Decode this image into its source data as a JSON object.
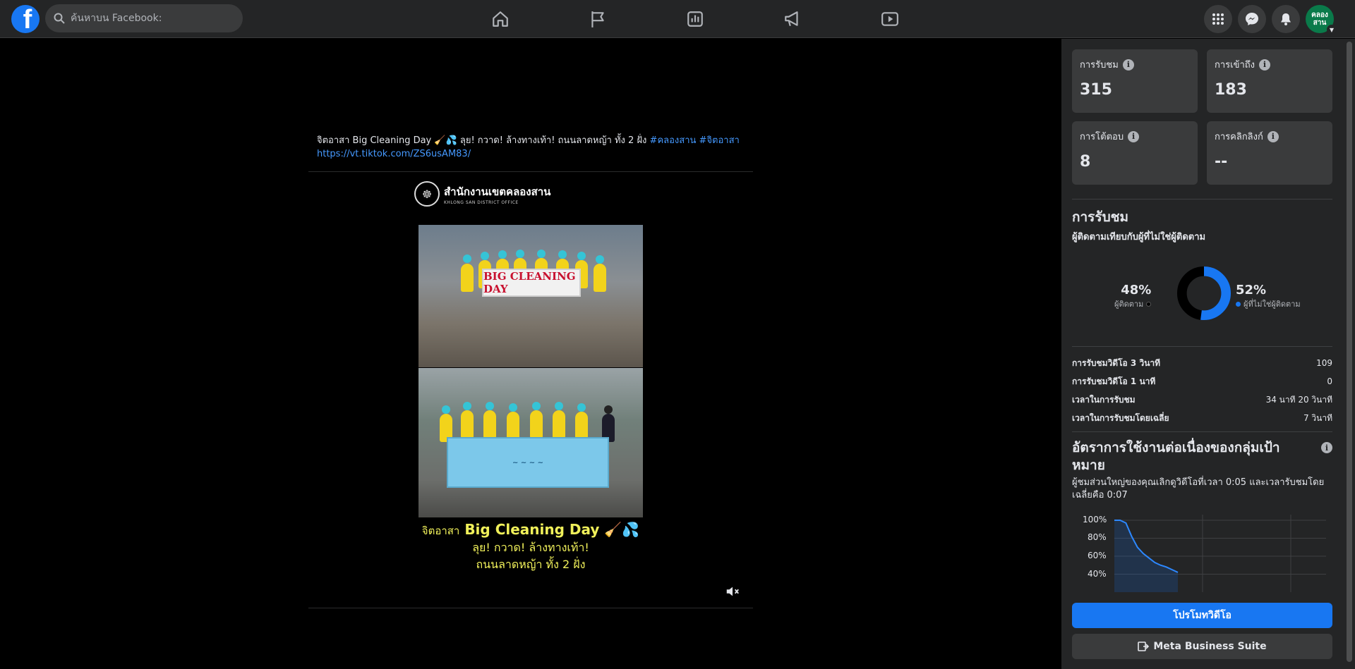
{
  "header": {
    "logo_letter": "f",
    "search_placeholder": "ค้นหาบน Facebook:",
    "nav_icons": [
      "home-icon",
      "pages-flag-icon",
      "insights-icon",
      "ads-megaphone-icon",
      "watch-video-icon"
    ],
    "right_icons": [
      "menu-grid-icon",
      "messenger-icon",
      "notifications-bell-icon"
    ],
    "avatar_text": "คลอง สาน"
  },
  "post": {
    "text": "จิตอาสา Big Cleaning Day 🧹💦 ลุย! กวาด! ล้างทางเท้า! ถนนลาดหญ้า ทั้ง 2 ฝั่ง ",
    "hashtags": "#คลองสาน #จิตอาสา",
    "link": "https://vt.tiktok.com/ZS6usAM83/",
    "video": {
      "office_name": "สำนักงานเขตคลองสาน",
      "office_sub": "KHLONG SAN DISTRICT OFFICE",
      "banner_text": "BIG CLEANING DAY",
      "caption_line1_small": "จิตอาสา",
      "caption_line1_big": "Big Cleaning Day 🧹💦",
      "caption_line2": "ลุย! กวาด! ล้างทางเท้า!",
      "caption_line3": "ถนนลาดหญ้า ทั้ง 2 ฝั่ง"
    }
  },
  "stats": [
    {
      "label": "การรับชม",
      "value": "315"
    },
    {
      "label": "การเข้าถึง",
      "value": "183"
    },
    {
      "label": "การโต้ตอบ",
      "value": "8"
    },
    {
      "label": "การคลิกลิงก์",
      "value": "--"
    }
  ],
  "views_section": {
    "title": "การรับชม",
    "subtitle": "ผู้ติดตามเทียบกับผู้ที่ไม่ใช่ผู้ติดตาม",
    "followers_pct": "48%",
    "followers_label": "ผู้ติดตาม",
    "non_followers_pct": "52%",
    "non_followers_label": "ผู้ที่ไม่ใช่ผู้ติดตาม",
    "followers_color": "#000000",
    "non_followers_color": "#1877f2"
  },
  "metrics": [
    {
      "label": "การรับชมวิดีโอ 3 วินาที",
      "value": "109"
    },
    {
      "label": "การรับชมวิดีโอ 1 นาที",
      "value": "0"
    },
    {
      "label": "เวลาในการรับชม",
      "value": "34 นาที 20 วินาที"
    },
    {
      "label": "เวลาในการรับชมโดยเฉลี่ย",
      "value": "7 วินาที"
    }
  ],
  "retention": {
    "title": "อัตราการใช้งานต่อเนื่องของกลุ่มเป้าหมาย",
    "subtitle": "ผู้ชมส่วนใหญ่ของคุณเลิกดูวิดีโอที่เวลา 0:05 และเวลารับชมโดยเฉลี่ยคือ 0:07",
    "y_ticks": [
      "100%",
      "80%",
      "60%",
      "40%"
    ]
  },
  "chart_data": {
    "type": "area",
    "title": "อัตราการใช้งานต่อเนื่องของกลุ่มเป้าหมาย",
    "ylabel": "",
    "xlabel": "",
    "ylim": [
      40,
      100
    ],
    "y_ticks": [
      "100%",
      "80%",
      "60%",
      "40%"
    ],
    "series": [
      {
        "values": [
          100,
          100,
          97,
          82,
          70,
          63,
          58,
          53,
          50,
          48,
          45,
          42
        ]
      }
    ],
    "grid": true
  },
  "buttons": {
    "promote": "โปรโมทวิดีโอ",
    "meta_business_suite": "Meta Business Suite"
  }
}
